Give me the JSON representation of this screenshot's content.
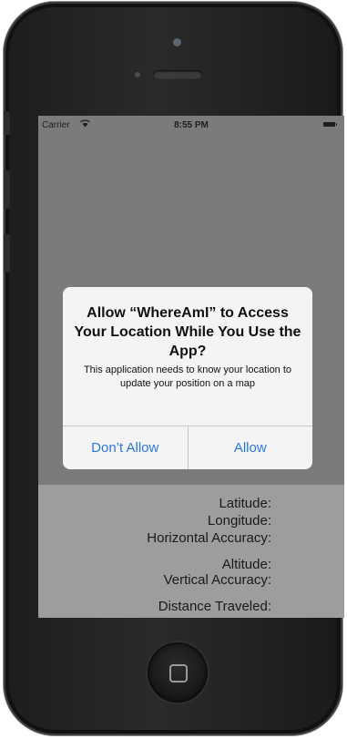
{
  "status_bar": {
    "carrier": "Carrier",
    "wifi_icon": "wifi-icon",
    "time": "8:55 PM",
    "battery_icon": "battery-icon"
  },
  "location_fields": {
    "latitude": "Latitude:",
    "longitude": "Longitude:",
    "horizontal_accuracy": "Horizontal Accuracy:",
    "altitude": "Altitude:",
    "vertical_accuracy": "Vertical Accuracy:",
    "distance_traveled": "Distance Traveled:"
  },
  "alert": {
    "title": "Allow “WhereAmI” to Access Your Location While You Use the App?",
    "message": "This application needs to know your location to update your position on a map",
    "deny_label": "Don’t Allow",
    "allow_label": "Allow",
    "accent_color": "#2a78dd"
  },
  "device": {
    "home_button_icon": "home-square-icon",
    "screen_dim_color": "#7b7b7b"
  }
}
